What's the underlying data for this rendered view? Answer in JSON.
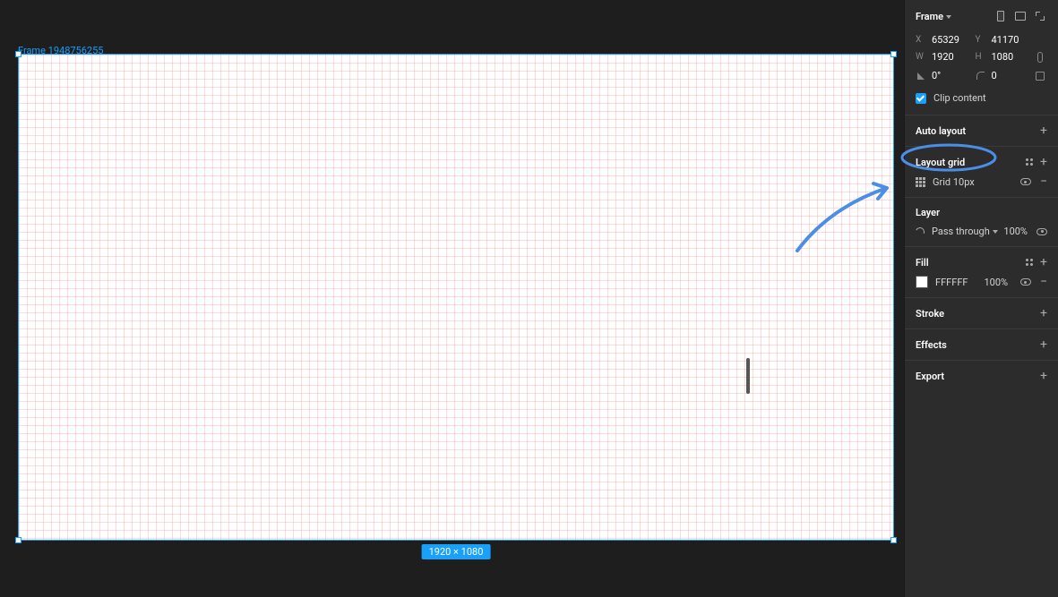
{
  "frame": {
    "label": "Frame 1948756255",
    "dimensions_badge": "1920 × 1080"
  },
  "panel": {
    "type": "Frame",
    "position": {
      "x_label": "X",
      "x": "65329",
      "y_label": "Y",
      "y": "41170"
    },
    "size": {
      "w_label": "W",
      "w": "1920",
      "h_label": "H",
      "h": "1080"
    },
    "rotation": {
      "value": "0°"
    },
    "radius": {
      "value": "0"
    },
    "clip_content": {
      "label": "Clip content",
      "checked": true
    },
    "auto_layout": {
      "title": "Auto layout"
    },
    "layout_grid": {
      "title": "Layout grid",
      "item": "Grid 10px"
    },
    "layer": {
      "title": "Layer",
      "blend": "Pass through",
      "opacity": "100%"
    },
    "fill": {
      "title": "Fill",
      "hex": "FFFFFF",
      "opacity": "100%"
    },
    "stroke": {
      "title": "Stroke"
    },
    "effects": {
      "title": "Effects"
    },
    "export": {
      "title": "Export"
    }
  }
}
